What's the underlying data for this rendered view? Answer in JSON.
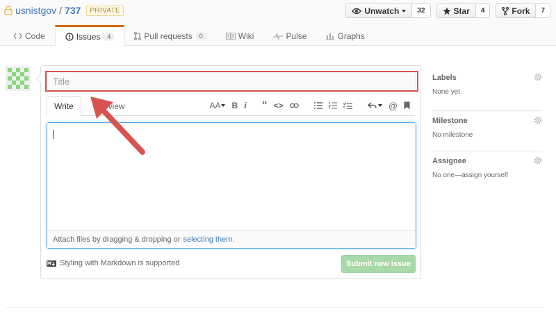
{
  "repo": {
    "owner": "usnistgov",
    "separator": "/",
    "name": "737",
    "visibility_badge": "PRIVATE"
  },
  "actions": {
    "watch_label": "Unwatch",
    "watch_count": "32",
    "star_label": "Star",
    "star_count": "4",
    "fork_label": "Fork",
    "fork_count": "7"
  },
  "nav": {
    "code": "Code",
    "issues": "Issues",
    "issues_count": "4",
    "pulls": "Pull requests",
    "pulls_count": "0",
    "wiki": "Wiki",
    "pulse": "Pulse",
    "graphs": "Graphs"
  },
  "form": {
    "title_placeholder": "Title",
    "tab_write": "Write",
    "tab_preview": "Preview",
    "toolbar": {
      "text_size": "AA",
      "bold": "B",
      "italic": "i",
      "quote": "“",
      "code": "<>",
      "at": "@"
    },
    "attach_text": "Attach files by dragging & dropping or",
    "attach_link": "selecting them",
    "attach_end": ".",
    "markdown_note": "Styling with Markdown is supported",
    "submit_label": "Submit new issue"
  },
  "sidebar": {
    "labels_heading": "Labels",
    "labels_value": "None yet",
    "milestone_heading": "Milestone",
    "milestone_value": "No milestone",
    "assignee_heading": "Assignee",
    "assignee_value": "No one—assign yourself"
  },
  "colors": {
    "accent_orange": "#d26911",
    "link_blue": "#4078c0",
    "highlight_red": "#d9534f",
    "submit_green": "#a8d9a8",
    "focus_blue": "#51a7e8"
  },
  "icons": [
    "lock-icon",
    "eye-icon",
    "star-icon",
    "fork-icon",
    "code-icon",
    "issue-icon",
    "pull-request-icon",
    "wiki-icon",
    "pulse-icon",
    "graph-icon",
    "gear-icon",
    "markdown-icon",
    "arrow-annotation"
  ]
}
